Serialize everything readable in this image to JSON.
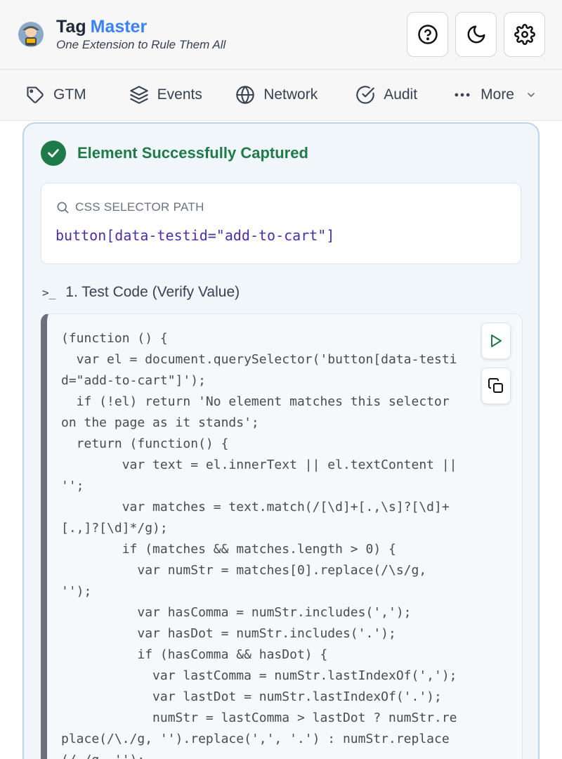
{
  "header": {
    "title_main": "Tag",
    "title_accent": "Master",
    "subtitle": "One Extension to Rule Them All",
    "buttons": [
      "help-icon",
      "moon-icon",
      "gear-icon"
    ]
  },
  "tabs": [
    {
      "label": "GTM",
      "icon": "tag-icon"
    },
    {
      "label": "Events",
      "icon": "layers-icon"
    },
    {
      "label": "Network",
      "icon": "globe-icon"
    },
    {
      "label": "Audit",
      "icon": "check-circle-icon"
    },
    {
      "label": "More",
      "icon": "more-icon"
    }
  ],
  "capture": {
    "status": "Element Successfully Captured",
    "selector_label": "CSS SELECTOR PATH",
    "selector_value": "button[data-testid=\"add-to-cart\"]",
    "test_heading": "1. Test Code (Verify Value)",
    "prompt_glyph": ">_",
    "code": "(function () {\n  var el = document.querySelector('button[data-testi\nd=\"add-to-cart\"]');\n  if (!el) return 'No element matches this selector\non the page as it stands';\n  return (function() {\n        var text = el.innerText || el.textContent ||\n'';\n        var matches = text.match(/[\\d]+[.,\\s]?[\\d]+\n[.,]?[\\d]*/g);\n        if (matches && matches.length > 0) {\n          var numStr = matches[0].replace(/\\s/g,\n'');\n          var hasComma = numStr.includes(',');\n          var hasDot = numStr.includes('.');\n          if (hasComma && hasDot) {\n            var lastComma = numStr.lastIndexOf(',');\n            var lastDot = numStr.lastIndexOf('.');\n            numStr = lastComma > lastDot ? numStr.re\nplace(/\\./g, '').replace(',', '.') : numStr.replace\n(/,/g, '');"
  },
  "colors": {
    "accent": "#3b82f6",
    "success": "#1f7a4a",
    "selector": "#4b2fa8"
  }
}
